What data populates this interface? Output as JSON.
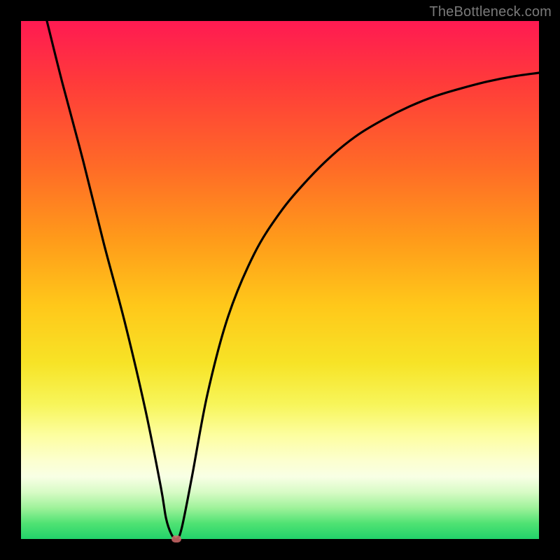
{
  "watermark": "TheBottleneck.com",
  "chart_data": {
    "type": "line",
    "title": "",
    "xlabel": "",
    "ylabel": "",
    "ylim": [
      0,
      100
    ],
    "xlim": [
      0,
      100
    ],
    "series": [
      {
        "name": "curve",
        "x": [
          5,
          8,
          12,
          16,
          20,
          24,
          27,
          28,
          29,
          30,
          31,
          33,
          36,
          40,
          45,
          50,
          55,
          60,
          65,
          70,
          75,
          80,
          85,
          90,
          95,
          100
        ],
        "y": [
          100,
          88,
          73,
          57,
          42,
          25,
          10,
          4,
          1,
          0,
          2,
          12,
          28,
          43,
          55,
          63,
          69,
          74,
          78,
          81,
          83.5,
          85.5,
          87,
          88.3,
          89.3,
          90
        ]
      }
    ],
    "markers": [
      {
        "name": "min-point",
        "x": 30,
        "y": 0
      }
    ],
    "colors": {
      "curve": "#000000",
      "marker": "#d06a6a",
      "gradient_top": "#ff1a52",
      "gradient_bottom": "#22d36a"
    }
  }
}
